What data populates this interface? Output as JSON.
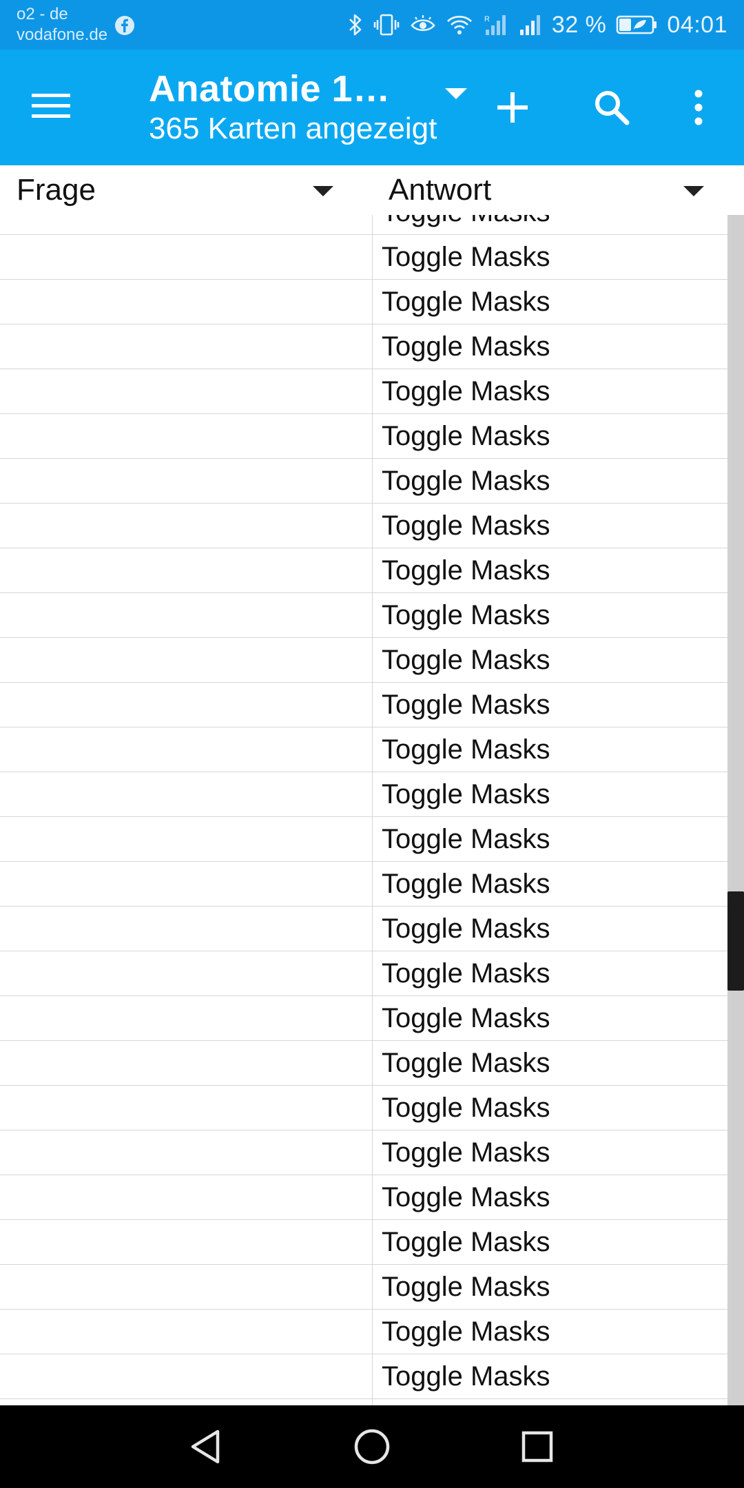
{
  "status_bar": {
    "carrier_line1": "o2 - de",
    "carrier_line2": "vodafone.de",
    "battery": "32 %",
    "time": "04:01",
    "icons": [
      "facebook-icon",
      "bluetooth-icon",
      "vibrate-icon",
      "eye-comfort-icon",
      "wifi-icon",
      "signal-r-icon",
      "signal-icon",
      "battery-icon"
    ]
  },
  "app_bar": {
    "deck_title": "Anatomie 1…",
    "card_count": "365 Karten angezeigt",
    "icons": [
      "menu-icon",
      "dropdown-icon",
      "add-icon",
      "search-icon",
      "overflow-icon"
    ]
  },
  "columns": {
    "question": "Frage",
    "answer": "Antwort"
  },
  "rows": [
    {
      "question": "",
      "answer": "Toggle Masks"
    },
    {
      "question": "",
      "answer": "Toggle Masks"
    },
    {
      "question": "",
      "answer": "Toggle Masks"
    },
    {
      "question": "",
      "answer": "Toggle Masks"
    },
    {
      "question": "",
      "answer": "Toggle Masks"
    },
    {
      "question": "",
      "answer": "Toggle Masks"
    },
    {
      "question": "",
      "answer": "Toggle Masks"
    },
    {
      "question": "",
      "answer": "Toggle Masks"
    },
    {
      "question": "",
      "answer": "Toggle Masks"
    },
    {
      "question": "",
      "answer": "Toggle Masks"
    },
    {
      "question": "",
      "answer": "Toggle Masks"
    },
    {
      "question": "",
      "answer": "Toggle Masks"
    },
    {
      "question": "",
      "answer": "Toggle Masks"
    },
    {
      "question": "",
      "answer": "Toggle Masks"
    },
    {
      "question": "",
      "answer": "Toggle Masks"
    },
    {
      "question": "",
      "answer": "Toggle Masks"
    },
    {
      "question": "",
      "answer": "Toggle Masks"
    },
    {
      "question": "",
      "answer": "Toggle Masks"
    },
    {
      "question": "",
      "answer": "Toggle Masks"
    },
    {
      "question": "",
      "answer": "Toggle Masks"
    },
    {
      "question": "",
      "answer": "Toggle Masks"
    },
    {
      "question": "",
      "answer": "Toggle Masks"
    },
    {
      "question": "",
      "answer": "Toggle Masks"
    },
    {
      "question": "",
      "answer": "Toggle Masks"
    },
    {
      "question": "",
      "answer": "Toggle Masks"
    },
    {
      "question": "",
      "answer": "Toggle Masks"
    },
    {
      "question": "",
      "answer": "Toggle Masks"
    },
    {
      "question": "",
      "answer": "Toggle Masks"
    }
  ],
  "scroll_position": 0.62,
  "nav_bar": {
    "icons": [
      "back-icon",
      "home-icon",
      "recents-icon"
    ]
  },
  "colors": {
    "status_bar": "#0e96e6",
    "app_bar": "#0ba8f2",
    "nav_bar": "#000000",
    "divider": "#d6d6d6"
  }
}
